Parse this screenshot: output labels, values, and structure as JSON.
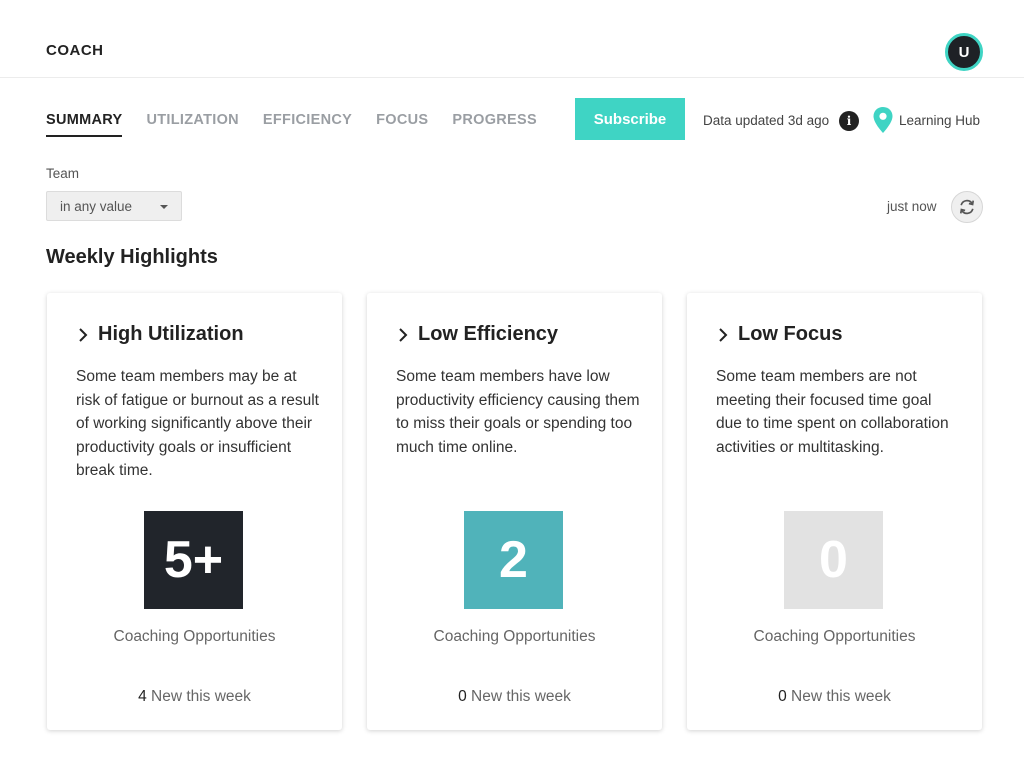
{
  "app": {
    "title": "COACH",
    "avatar_initial": "U"
  },
  "tabs": [
    {
      "label": "SUMMARY",
      "active": true
    },
    {
      "label": "UTILIZATION",
      "active": false
    },
    {
      "label": "EFFICIENCY",
      "active": false
    },
    {
      "label": "FOCUS",
      "active": false
    },
    {
      "label": "PROGRESS",
      "active": false
    }
  ],
  "toolbar": {
    "subscribe_label": "Subscribe",
    "data_updated": "Data updated 3d ago",
    "info_icon": "info-icon",
    "learning_hub_label": "Learning Hub",
    "learning_hub_icon": "map-pin-icon"
  },
  "filters": {
    "team_label": "Team",
    "team_value": "in any value",
    "refreshed": "just now",
    "refresh_icon": "refresh-icon"
  },
  "section": {
    "title": "Weekly Highlights"
  },
  "cards": [
    {
      "title": "High Utilization",
      "description": "Some team members may be at risk of fatigue or burnout as a result of working significantly above their productivity goals or insufficient break time.",
      "count": "5+",
      "count_color": "#21252b",
      "opportunities_label": "Coaching Opportunities",
      "new_count": "4",
      "new_label": "New this week"
    },
    {
      "title": "Low Efficiency",
      "description": "Some team members have low productivity efficiency causing them to miss their goals or spending too much time online.",
      "count": "2",
      "count_color": "#50b3ba",
      "opportunities_label": "Coaching Opportunities",
      "new_count": "0",
      "new_label": "New this week"
    },
    {
      "title": "Low Focus",
      "description": "Some team members are not meeting their focused time goal due to time spent on collaboration activities or multitasking.",
      "count": "0",
      "count_color": "#e2e2e2",
      "opportunities_label": "Coaching Opportunities",
      "new_count": "0",
      "new_label": "New this week"
    }
  ],
  "colors": {
    "accent": "#3fd4c4",
    "dark": "#21252b",
    "teal": "#50b3ba",
    "muted": "#e2e2e2"
  }
}
